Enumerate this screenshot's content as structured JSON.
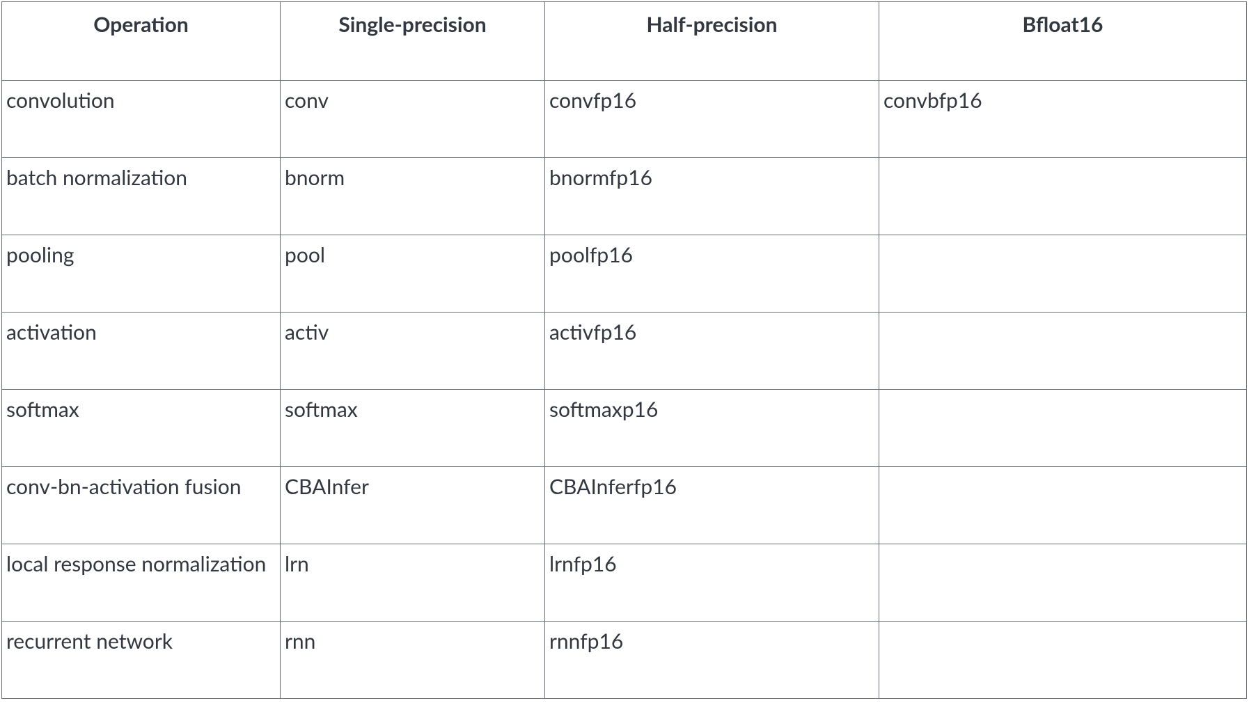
{
  "chart_data": {
    "type": "table",
    "columns": [
      "Operation",
      "Single-precision",
      "Half-precision",
      "Bfloat16"
    ],
    "rows": [
      [
        "convolution",
        "conv",
        "convfp16",
        "convbfp16"
      ],
      [
        "batch normalization",
        "bnorm",
        "bnormfp16",
        ""
      ],
      [
        "pooling",
        "pool",
        "poolfp16",
        ""
      ],
      [
        "activation",
        "activ",
        "activfp16",
        ""
      ],
      [
        "softmax",
        "softmax",
        "softmaxp16",
        ""
      ],
      [
        "conv-bn-activation fusion",
        "CBAInfer",
        "CBAInferfp16",
        ""
      ],
      [
        "local response normalization",
        "lrn",
        "lrnfp16",
        ""
      ],
      [
        "recurrent network",
        "rnn",
        "rnnfp16",
        ""
      ]
    ]
  }
}
